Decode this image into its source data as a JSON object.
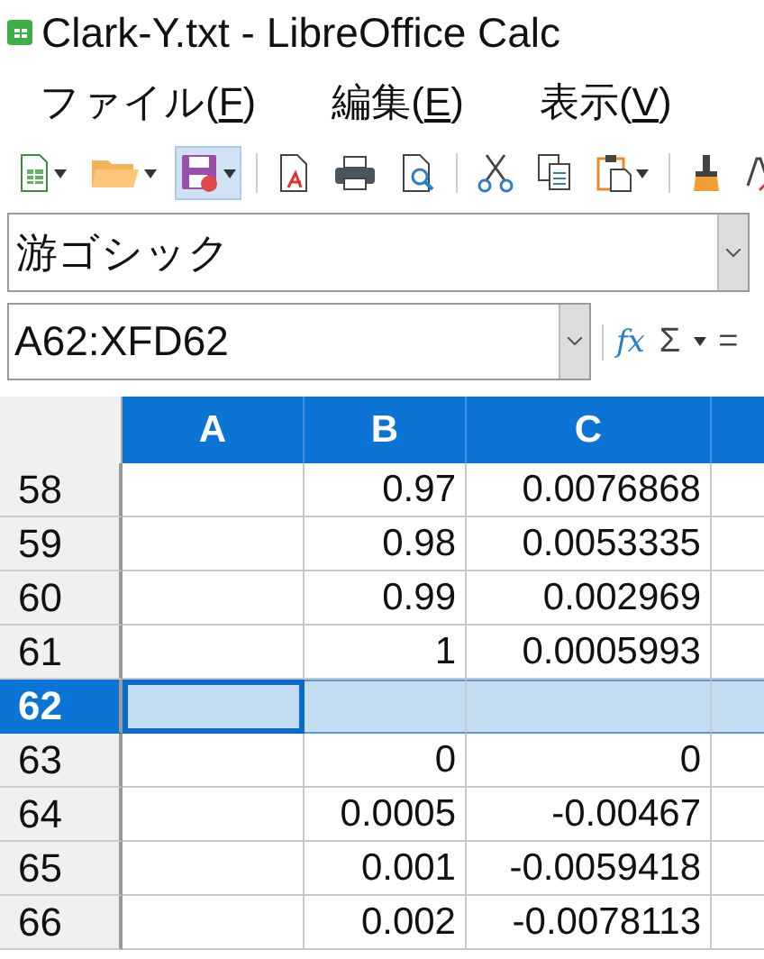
{
  "window": {
    "title": "Clark-Y.txt - LibreOffice Calc"
  },
  "menu": [
    {
      "before": "ファイル(",
      "key": "F",
      "after": ")"
    },
    {
      "before": "編集(",
      "key": "E",
      "after": ")"
    },
    {
      "before": "表示(",
      "key": "V",
      "after": ")"
    }
  ],
  "toolbar": [
    {
      "kind": "new-sheet",
      "dropdown": true,
      "highlighted": false
    },
    {
      "kind": "open",
      "dropdown": true,
      "highlighted": false
    },
    {
      "kind": "save",
      "dropdown": true,
      "highlighted": true
    },
    {
      "kind": "sep"
    },
    {
      "kind": "pdf",
      "dropdown": false,
      "highlighted": false
    },
    {
      "kind": "print",
      "dropdown": false,
      "highlighted": false
    },
    {
      "kind": "preview",
      "dropdown": false,
      "highlighted": false
    },
    {
      "kind": "sep"
    },
    {
      "kind": "cut",
      "dropdown": false,
      "highlighted": false
    },
    {
      "kind": "copy",
      "dropdown": false,
      "highlighted": false
    },
    {
      "kind": "paste",
      "dropdown": true,
      "highlighted": false
    },
    {
      "kind": "sep"
    },
    {
      "kind": "brush",
      "dropdown": false,
      "highlighted": false
    },
    {
      "kind": "clear",
      "dropdown": false,
      "highlighted": false
    }
  ],
  "font_name": {
    "value": "游ゴシック"
  },
  "formula_bar": {
    "name_box": "A62:XFD62",
    "function_wizard": "fx",
    "sum": "Σ",
    "equals": "="
  },
  "sheet": {
    "columns": [
      {
        "label": "A",
        "selected": true
      },
      {
        "label": "B",
        "selected": true
      },
      {
        "label": "C",
        "selected": true
      },
      {
        "selected": true
      }
    ],
    "rows": [
      {
        "header": "58",
        "selected": false,
        "cells": [
          "",
          "0.97",
          "0.0076868"
        ]
      },
      {
        "header": "59",
        "selected": false,
        "cells": [
          "",
          "0.98",
          "0.0053335"
        ]
      },
      {
        "header": "60",
        "selected": false,
        "cells": [
          "",
          "0.99",
          "0.002969"
        ]
      },
      {
        "header": "61",
        "selected": false,
        "cells": [
          "",
          "1",
          "0.0005993"
        ]
      },
      {
        "header": "62",
        "selected": true,
        "cells": [
          "",
          "",
          ""
        ]
      },
      {
        "header": "63",
        "selected": false,
        "cells": [
          "",
          "0",
          "0"
        ]
      },
      {
        "header": "64",
        "selected": false,
        "cells": [
          "",
          "0.0005",
          "-0.00467"
        ]
      },
      {
        "header": "65",
        "selected": false,
        "cells": [
          "",
          "0.001",
          "-0.0059418"
        ]
      },
      {
        "header": "66",
        "selected": false,
        "cells": [
          "",
          "0.002",
          "-0.0078113"
        ]
      }
    ]
  }
}
